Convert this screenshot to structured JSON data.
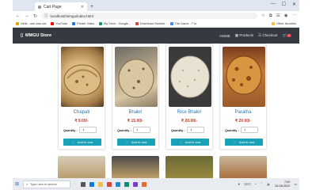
{
  "browser": {
    "tab_title": "Cart Page",
    "new_tab": "+",
    "url": "localhost/mimgu/index.html",
    "bookmarks": [
      {
        "label": "Hello - use own-sai",
        "icon_color": "#e0a800"
      },
      {
        "label": "YouTube",
        "icon_color": "#ff0000"
      },
      {
        "label": "Printer Video",
        "icon_color": "#1a73e8"
      },
      {
        "label": "My Drive - Google...",
        "icon_color": "#0f9d58"
      },
      {
        "label": "Download Youtube",
        "icon_color": "#db4437"
      },
      {
        "label": "The Game - T'm",
        "icon_color": "#4285f4"
      }
    ],
    "other_favorites": "Other favorites"
  },
  "navbar": {
    "brand": "MMGU Store",
    "links": [
      "HOME",
      "Products",
      "Checkout"
    ],
    "cart_count": "0"
  },
  "products": [
    {
      "name": "Chapati",
      "price": "₹ 9.00/-",
      "qty_label": "Quantity :",
      "qty_value": "1",
      "button": "Add to cart"
    },
    {
      "name": "Bhakri",
      "price": "₹ 15.00/-",
      "qty_label": "Quantity :",
      "qty_value": "1",
      "button": "Add to cart"
    },
    {
      "name": "Rice Bhakri",
      "price": "₹ 20.00/-",
      "qty_label": "Quantity :",
      "qty_value": "1",
      "button": "Add to cart"
    },
    {
      "name": "Paratha",
      "price": "₹ 20.00/-",
      "qty_label": "Quantity :",
      "qty_value": "1",
      "button": "Add to cart"
    }
  ],
  "taskbar": {
    "search_placeholder": "Type here to search",
    "weather": "29°C",
    "time": "7:00",
    "date": "26-08-2022"
  },
  "colors": {
    "navbar": "#343a40",
    "button": "#17a2b8",
    "price": "#c0392b",
    "title": "#2a7ab0"
  }
}
